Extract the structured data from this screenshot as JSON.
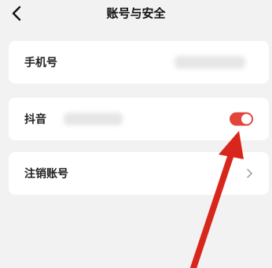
{
  "header": {
    "title": "账号与安全",
    "back_icon": "chevron-left-icon"
  },
  "rows": [
    {
      "label": "手机号",
      "value_hidden": true
    },
    {
      "label": "抖音",
      "value_hidden": true,
      "toggle_on": true
    },
    {
      "label": "注销账号",
      "trailing_icon": "chevron-right-icon"
    }
  ],
  "colors": {
    "background": "#f2f2f2",
    "card": "#ffffff",
    "toggle_on": "#e2463a",
    "annotation_arrow": "#d9261c"
  }
}
